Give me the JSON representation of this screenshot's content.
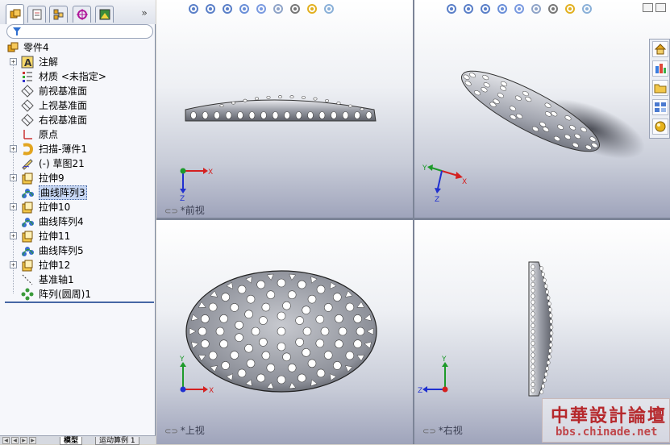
{
  "feature_manager": {
    "collapse_glyph": "»",
    "tree": [
      {
        "label": "零件4",
        "icon": "part-icon",
        "expand": false
      },
      {
        "label": "注解",
        "icon": "annotation-icon",
        "expand": true
      },
      {
        "label": "材质 <未指定>",
        "icon": "material-icon",
        "expand": false
      },
      {
        "label": "前视基准面",
        "icon": "plane-icon",
        "expand": false
      },
      {
        "label": "上视基准面",
        "icon": "plane-icon",
        "expand": false
      },
      {
        "label": "右视基准面",
        "icon": "plane-icon",
        "expand": false
      },
      {
        "label": "原点",
        "icon": "origin-icon",
        "expand": false
      },
      {
        "label": "扫描-薄件1",
        "icon": "sweep-icon",
        "expand": true
      },
      {
        "label": "(-) 草图21",
        "icon": "sketch-icon",
        "expand": false
      },
      {
        "label": "拉伸9",
        "icon": "extrude-icon",
        "expand": true
      },
      {
        "label": "曲线阵列3",
        "icon": "curve-pattern-icon",
        "expand": false,
        "selected": true
      },
      {
        "label": "拉伸10",
        "icon": "extrude-icon",
        "expand": true
      },
      {
        "label": "曲线阵列4",
        "icon": "curve-pattern-icon",
        "expand": false
      },
      {
        "label": "拉伸11",
        "icon": "extrude-icon",
        "expand": true
      },
      {
        "label": "曲线阵列5",
        "icon": "curve-pattern-icon",
        "expand": false
      },
      {
        "label": "拉伸12",
        "icon": "extrude-icon",
        "expand": true
      },
      {
        "label": "基准轴1",
        "icon": "axis-icon",
        "expand": false
      },
      {
        "label": "阵列(圆周)1",
        "icon": "circular-pattern-icon",
        "expand": false
      }
    ],
    "bottom_tabs": {
      "model": "模型",
      "motion": "运动算例 1"
    }
  },
  "viewports": {
    "front": {
      "label": "*前视"
    },
    "top": {
      "label": "*上视"
    },
    "right": {
      "label": "*右视"
    },
    "iso": {
      "label": ""
    }
  },
  "triad": {
    "x": "X",
    "y": "Y",
    "z": "Z"
  },
  "colors": {
    "axis_x": "#d42020",
    "axis_y": "#1d9a2a",
    "axis_z": "#2030d0",
    "accent": "#4667a4"
  },
  "watermark": {
    "title": "中華設計論壇",
    "url": "bbs.chinade.net"
  }
}
